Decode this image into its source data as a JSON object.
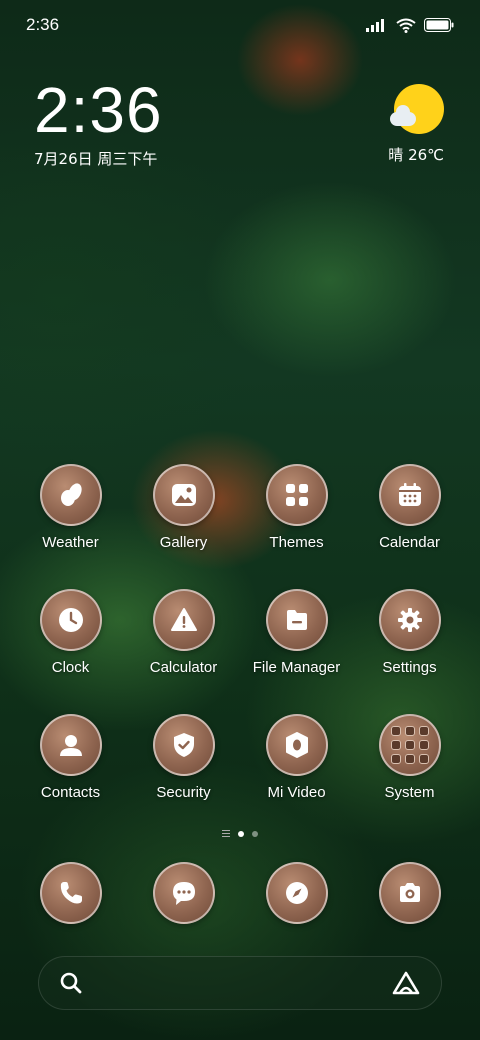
{
  "status_bar": {
    "time": "2:36"
  },
  "clock_widget": {
    "time": "2:36",
    "date": "7月26日 周三下午"
  },
  "weather_widget": {
    "text": "晴 26℃",
    "sun_color": "#ffd21a"
  },
  "apps": [
    [
      {
        "label": "Weather",
        "icon": "weather-icon"
      },
      {
        "label": "Gallery",
        "icon": "gallery-icon"
      },
      {
        "label": "Themes",
        "icon": "themes-icon"
      },
      {
        "label": "Calendar",
        "icon": "calendar-icon"
      }
    ],
    [
      {
        "label": "Clock",
        "icon": "clock-icon"
      },
      {
        "label": "Calculator",
        "icon": "calculator-icon"
      },
      {
        "label": "File Manager",
        "icon": "file-manager-icon"
      },
      {
        "label": "Settings",
        "icon": "settings-icon"
      }
    ],
    [
      {
        "label": "Contacts",
        "icon": "contacts-icon"
      },
      {
        "label": "Security",
        "icon": "security-icon"
      },
      {
        "label": "Mi Video",
        "icon": "mi-video-icon"
      },
      {
        "label": "System",
        "icon": "system-folder-icon"
      }
    ]
  ],
  "dock": [
    "phone-icon",
    "messages-icon",
    "browser-icon",
    "camera-icon"
  ],
  "page_indicator": {
    "pages": 2,
    "active": 1
  },
  "colors": {
    "icon_bg": "#8f6550",
    "icon_border": "#ffffff"
  }
}
